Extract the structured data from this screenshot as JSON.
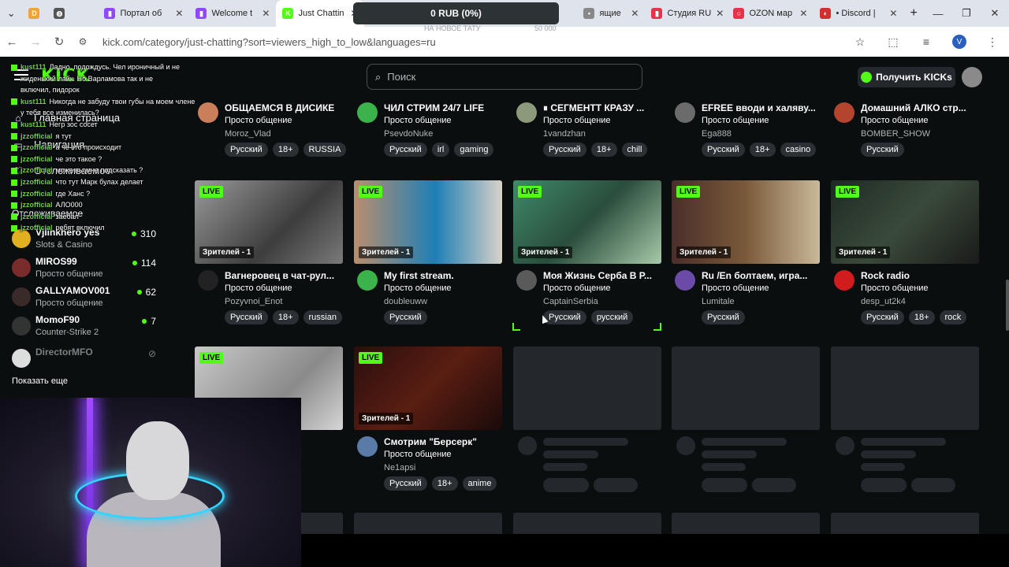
{
  "browser": {
    "tabs": [
      {
        "label": "",
        "color": "#f3a13a",
        "glyph": "D"
      },
      {
        "label": "",
        "color": "#555",
        "glyph": "◍"
      },
      {
        "label": "Портал об",
        "color": "#9146ff",
        "glyph": "▮"
      },
      {
        "label": "Welcome t",
        "color": "#9146ff",
        "glyph": "▮"
      },
      {
        "label": "Just Chattin",
        "color": "#53fc18",
        "glyph": "K"
      },
      {
        "label": "ящие",
        "color": "#888",
        "glyph": "•"
      },
      {
        "label": "Студия RU",
        "color": "#e8324a",
        "glyph": "▮"
      },
      {
        "label": "OZON мар",
        "color": "#e8324a",
        "glyph": "○"
      },
      {
        "label": "• Discord |",
        "color": "#d23030",
        "glyph": "◐"
      }
    ],
    "url": "kick.com/category/just-chatting?sort=viewers_high_to_low&languages=ru",
    "profile_letter": "V"
  },
  "donation": {
    "title": "0 RUB (0%)",
    "sub_left": "НА НОВОЕ ТАТУ",
    "sub_right": "50 000"
  },
  "header": {
    "logo": "KICK",
    "search_placeholder": "Поиск",
    "get_kicks": "Получить KICKs"
  },
  "sidebar": {
    "home": "Главная страница",
    "browse": "Навигация",
    "following": "Отслеживаемое",
    "following_title": "Отслеживаемое",
    "items": [
      {
        "name": "Vjlinkhero yes",
        "cat": "Slots & Casino",
        "viewers": "310",
        "online": true
      },
      {
        "name": "MIROS99",
        "cat": "Просто общение",
        "viewers": "114",
        "online": true
      },
      {
        "name": "GALLYAMOV001",
        "cat": "Просто общение",
        "viewers": "62",
        "online": true
      },
      {
        "name": "MomoF90",
        "cat": "Counter-Strike 2",
        "viewers": "7",
        "online": true
      },
      {
        "name": "DirectorMFO",
        "cat": "",
        "viewers": "",
        "online": false
      }
    ],
    "show_more": "Показать еще"
  },
  "chat": [
    {
      "user": "kust111",
      "text": "Ладно, подождусь. Чел ироничный и не"
    },
    {
      "user": "",
      "text": "жиденький лайк. Но Варламова так и не"
    },
    {
      "user": "",
      "text": "включил, пидорок"
    },
    {
      "user": "kust111",
      "text": "Никогда не забуду твои губы на моем члене"
    },
    {
      "user": "",
      "text": "у тебя все изменилась?"
    },
    {
      "user": "kust111",
      "text": "Негр зос сосет"
    },
    {
      "user": "jzzofficial",
      "text": "я тут"
    },
    {
      "user": "jzzofficial",
      "text": "а че это происходит"
    },
    {
      "user": "jzzofficial",
      "text": "че это такое ?"
    },
    {
      "user": "jzzofficial",
      "text": "може вы мне подсказать ?"
    },
    {
      "user": "jzzofficial",
      "text": "что тут Марк булах делает"
    },
    {
      "user": "jzzofficial",
      "text": "где Ханс ?"
    },
    {
      "user": "jzzofficial",
      "text": "АЛО000"
    },
    {
      "user": "jzzofficial",
      "text": "заебал"
    },
    {
      "user": "jzzofficial",
      "text": "ребят включил"
    }
  ],
  "streams_row1": [
    {
      "title": "ОБЩАЕМСЯ В ДИСИКЕ",
      "category": "Просто общение",
      "streamer": "Moroz_Vlad",
      "tags": [
        "Русский",
        "18+",
        "RUSSIA"
      ],
      "avatar": "#c87f5a"
    },
    {
      "title": "ЧИЛ СТРИМ 24/7 LIFE",
      "category": "Просто общение",
      "streamer": "PsevdoNuke",
      "tags": [
        "Русский",
        "irl",
        "gaming"
      ],
      "avatar": "#3bb34a"
    },
    {
      "title": "⏸ СЕГМЕНТТ КРАЗУ ...",
      "category": "Просто общение",
      "streamer": "1vandzhan",
      "tags": [
        "Русский",
        "18+",
        "chill"
      ],
      "avatar": "#8a9a7a"
    },
    {
      "title": "EFREE вводи и халяву...",
      "category": "Просто общение",
      "streamer": "Ega888",
      "tags": [
        "Русский",
        "18+",
        "casino"
      ],
      "avatar": "#6b6b6b"
    },
    {
      "title": "Домашний АЛКО стр...",
      "category": "Просто общение",
      "streamer": "BOMBER_SHOW",
      "tags": [
        "Русский"
      ],
      "avatar": "#b3452e"
    }
  ],
  "streams_row2": [
    {
      "title": "Вагнеровец в чат-рул...",
      "category": "Просто общение",
      "streamer": "Pozyvnoi_Enot",
      "tags": [
        "Русский",
        "18+",
        "russian"
      ],
      "live": "LIVE",
      "viewers": "Зрителей - 1",
      "thumb": "linear-gradient(135deg,#9a9a9a,#3d3d3d 60%,#7a7a7a)",
      "avatar": "#222"
    },
    {
      "title": "My first stream.",
      "category": "Просто общение",
      "streamer": "doubleuww",
      "tags": [
        "Русский"
      ],
      "live": "LIVE",
      "viewers": "Зрителей - 1",
      "thumb": "linear-gradient(90deg,#b98e6e,#1e7fb5 55%,#d9d2c9)",
      "avatar": "#3bb34a"
    },
    {
      "title": "Моя Жизнь Серба В Р...",
      "category": "Просто общение",
      "streamer": "CaptainSerbia",
      "tags": [
        "Русский",
        "русский"
      ],
      "live": "LIVE",
      "viewers": "Зрителей - 1",
      "thumb": "linear-gradient(135deg,#3f8a6a,#2a4d3c 50%,#a8c9a9)",
      "avatar": "#5a5a5a"
    },
    {
      "title": "Ru /En болтаем, игра...",
      "category": "Просто общение",
      "streamer": "Lumitale",
      "tags": [
        "Русский"
      ],
      "live": "LIVE",
      "viewers": "Зрителей - 1",
      "thumb": "linear-gradient(90deg,#4a2e2a,#7a5a3a 50%,#c9b99a)",
      "avatar": "#6b4aa8"
    },
    {
      "title": "Rock radio",
      "category": "Просто общение",
      "streamer": "desp_ut2k4",
      "tags": [
        "Русский",
        "18+",
        "rock"
      ],
      "live": "LIVE",
      "viewers": "Зрителей - 1",
      "thumb": "linear-gradient(135deg,#1e2a24,#3a4a3a 50%,#1a1a1a)",
      "avatar": "#d01c1c"
    }
  ],
  "streams_row3": [
    {
      "title": "",
      "category": "",
      "streamer": "",
      "tags": [],
      "live": "LIVE",
      "viewers": "",
      "thumb": "linear-gradient(135deg,#c9c9c9,#8a8a8a 60%,#d6d6d6)",
      "avatar": ""
    },
    {
      "title": "Смотрим \"Берсерк\"",
      "category": "Просто общение",
      "streamer": "Ne1apsi",
      "tags": [
        "Русский",
        "18+",
        "anime"
      ],
      "live": "LIVE",
      "viewers": "Зрителей - 1",
      "thumb": "linear-gradient(135deg,#2a0e0e,#5a1e12 50%,#1a0a0a)",
      "avatar": "#5a7aa8"
    }
  ]
}
